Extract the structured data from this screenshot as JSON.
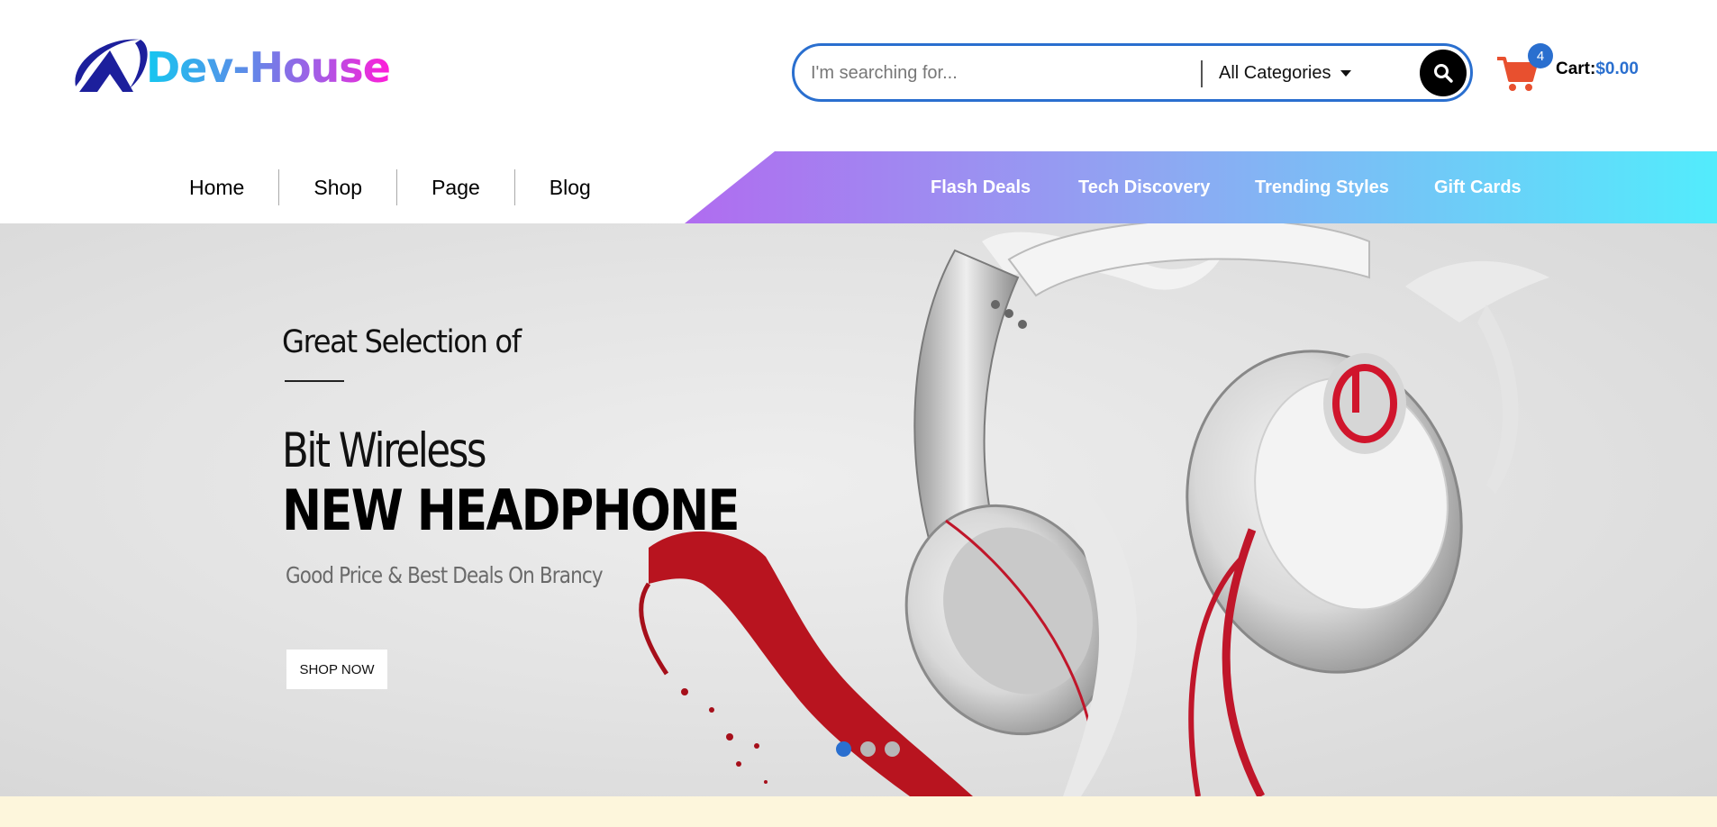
{
  "brand": {
    "name": "Dev-House",
    "logo_icon": "triangle-swoosh-logo"
  },
  "search": {
    "placeholder": "I'm searching for...",
    "value": "",
    "category": "All Categories",
    "button_icon": "search-icon"
  },
  "cart": {
    "badge_count": "4",
    "label": "Cart:",
    "amount": "$0.00",
    "icon": "shopping-cart-icon",
    "icon_color": "#e8502f"
  },
  "nav": {
    "main": [
      {
        "label": "Home"
      },
      {
        "label": "Shop"
      },
      {
        "label": "Page"
      },
      {
        "label": "Blog"
      }
    ],
    "promo": [
      {
        "label": "Flash Deals"
      },
      {
        "label": "Tech Discovery"
      },
      {
        "label": "Trending Styles"
      },
      {
        "label": "Gift Cards"
      }
    ],
    "band_gradient": [
      "#b06cf0",
      "#52ecfc"
    ]
  },
  "hero": {
    "eyebrow": "Great Selection of",
    "line1": "Bit Wireless",
    "line2": "NEW HEADPHONE",
    "subtitle": "Good Price & Best Deals On Brancy",
    "cta": "SHOP NOW",
    "slides": 3,
    "active_slide": 1,
    "accent": "#2a6fcf"
  }
}
